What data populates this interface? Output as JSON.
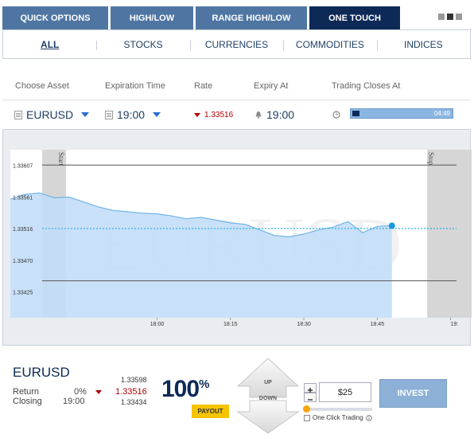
{
  "top_tabs": [
    {
      "label": "QUICK OPTIONS",
      "active": false
    },
    {
      "label": "HIGH/LOW",
      "active": false
    },
    {
      "label": "RANGE HIGH/LOW",
      "active": false
    },
    {
      "label": "ONE TOUCH",
      "active": true
    }
  ],
  "sub_tabs": [
    {
      "label": "ALL",
      "active": true
    },
    {
      "label": "STOCKS",
      "active": false
    },
    {
      "label": "CURRENCIES",
      "active": false
    },
    {
      "label": "COMMODITIES",
      "active": false
    },
    {
      "label": "INDICES",
      "active": false
    }
  ],
  "headers": {
    "choose_asset": "Choose Asset",
    "expiration_time": "Expiration Time",
    "rate": "Rate",
    "expiry_at": "Expiry At",
    "trading_closes_at": "Trading Closes At"
  },
  "asset_row": {
    "asset": "EURUSD",
    "expiration": "19:00",
    "rate": "1.33516",
    "expiry_at": "19:00",
    "closes_countdown": "04:49",
    "closes_progress": 0.07
  },
  "chart_data": {
    "type": "line",
    "watermark": "EURUSD",
    "yticks": [
      "1.33607",
      "1.33561",
      "1.33516",
      "1.33470",
      "1.33425"
    ],
    "xticks": [
      "18:00",
      "18:15",
      "18:30",
      "18:45",
      "19:"
    ],
    "start_label": "Start",
    "stop_label": "Stop",
    "ylim": [
      1.33388,
      1.33629
    ],
    "xlim": [
      17.5,
      19.02
    ],
    "start_x": 17.69,
    "stop_x": 18.92,
    "current_rate": 1.33516,
    "upper_barrier": 1.33607,
    "lower_barrier": 1.33441,
    "x": [
      17.5,
      17.55,
      17.6,
      17.65,
      17.7,
      17.75,
      17.8,
      17.85,
      17.9,
      17.95,
      18.0,
      18.05,
      18.1,
      18.15,
      18.2,
      18.25,
      18.3,
      18.35,
      18.4,
      18.45,
      18.5,
      18.55,
      18.6,
      18.65,
      18.7,
      18.75,
      18.8
    ],
    "y": [
      1.33558,
      1.33565,
      1.33567,
      1.3356,
      1.33561,
      1.33554,
      1.33547,
      1.33542,
      1.3354,
      1.33538,
      1.33537,
      1.33534,
      1.3353,
      1.33532,
      1.33528,
      1.33524,
      1.33522,
      1.33514,
      1.33506,
      1.33504,
      1.33508,
      1.33514,
      1.33518,
      1.33526,
      1.3351,
      1.33519,
      1.3352
    ]
  },
  "bottom": {
    "asset": "EURUSD",
    "return_label": "Return",
    "return_value": "0%",
    "closing_label": "Closing",
    "closing_value": "19:00",
    "high": "1.33598",
    "current": "1.33516",
    "low": "1.33434",
    "payout_value": "100",
    "payout_unit": "%",
    "payout_label": "PAYOUT",
    "up_label": "UP",
    "down_label": "DOWN",
    "amount": "$25",
    "slider_level": 0,
    "one_click_label": "One Click Trading",
    "invest_label": "INVEST"
  },
  "colors": {
    "tab_bg": "#4f76a3",
    "tab_active": "#0d2a57",
    "area_fill": "#c3def7",
    "line": "#6fb4ea",
    "rate_line": "#1aaae8",
    "payout_badge": "#f5c400",
    "invest_bg": "#8cb0d6",
    "down_red": "#b00000"
  }
}
